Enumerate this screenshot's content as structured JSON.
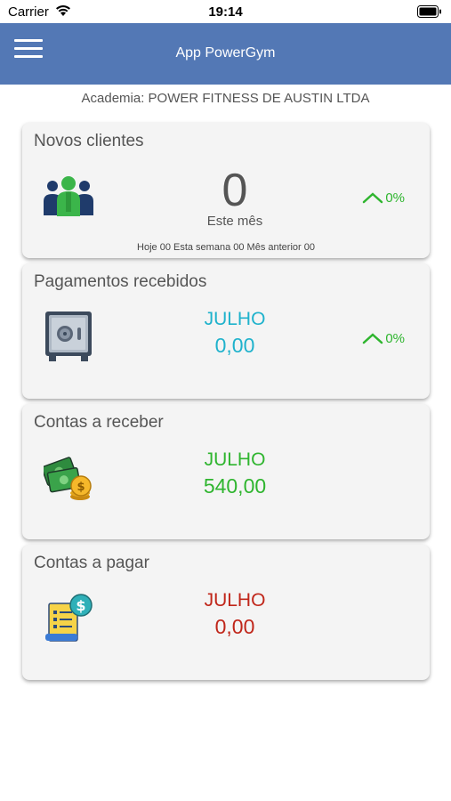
{
  "status_bar": {
    "carrier": "Carrier",
    "time": "19:14"
  },
  "app_bar": {
    "title": "App PowerGym"
  },
  "gym_name": "Academia: POWER FITNESS DE AUSTIN LTDA",
  "colors": {
    "app_bar": "#5378b5",
    "trend_up": "#2fb52f",
    "payments": "#1fb2cc",
    "receivables": "#2fb52f",
    "payables": "#c0261a"
  },
  "cards": [
    {
      "title": "Novos clientes",
      "icon": "people-icon",
      "value": "0",
      "caption": "Este mês",
      "trend": "0%",
      "footer": "Hoje 00 Esta semana 00 Mês anterior 00"
    },
    {
      "title": "Pagamentos recebidos",
      "icon": "safe-icon",
      "month": "JULHO",
      "amount": "0,00",
      "trend": "0%"
    },
    {
      "title": "Contas a receber",
      "icon": "money-icon",
      "month": "JULHO",
      "amount": "540,00"
    },
    {
      "title": "Contas a pagar",
      "icon": "bill-icon",
      "month": "JULHO",
      "amount": "0,00"
    }
  ]
}
